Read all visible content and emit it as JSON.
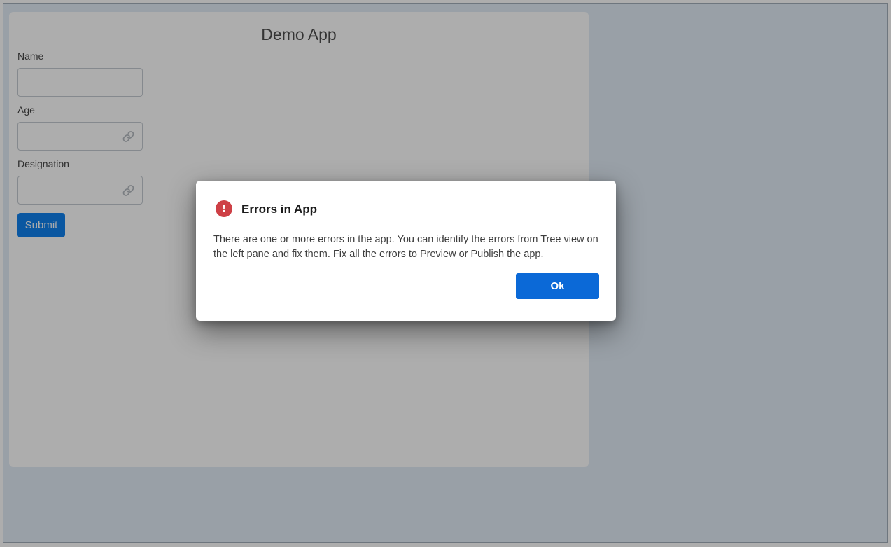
{
  "app": {
    "title": "Demo App",
    "fields": [
      {
        "label": "Name",
        "value": "",
        "has_link_icon": false
      },
      {
        "label": "Age",
        "value": "",
        "has_link_icon": true
      },
      {
        "label": "Designation",
        "value": "",
        "has_link_icon": true
      }
    ],
    "submit_label": "Submit"
  },
  "dialog": {
    "title": "Errors in App",
    "message": "There are one or more errors in the app. You can identify the errors from Tree view on the left pane and fix them. Fix all the errors to Preview or Publish the app.",
    "ok_label": "Ok",
    "icon_glyph": "!"
  },
  "colors": {
    "canvas_background": "#e2ecf6",
    "canvas_border": "#a3aeba",
    "submit_button": "#0f80ee",
    "ok_button": "#0b69d7",
    "error_icon": "#ce4046"
  }
}
